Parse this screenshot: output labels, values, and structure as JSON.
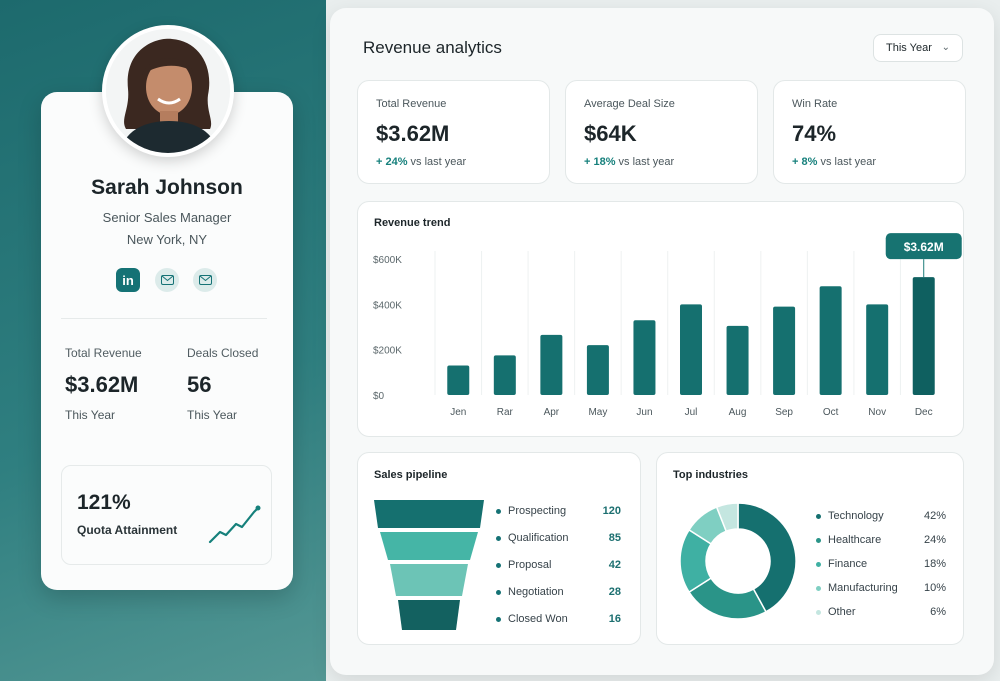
{
  "profile": {
    "name": "Sarah Johnson",
    "title": "Senior Sales Manager",
    "location": "New York, NY",
    "social": {
      "linkedin_label": "in"
    },
    "stats": [
      {
        "label": "Total Revenue",
        "value": "$3.62M",
        "sub": "This Year"
      },
      {
        "label": "Deals Closed",
        "value": "56",
        "sub": "This Year"
      }
    ],
    "quota": {
      "value": "121%",
      "label": "Quota Attainment"
    }
  },
  "header": {
    "title": "Revenue analytics",
    "period_select": "This Year"
  },
  "kpis": [
    {
      "label": "Total Revenue",
      "value": "$3.62M",
      "delta": "+ 24%",
      "delta_suffix": " vs last year"
    },
    {
      "label": "Average Deal Size",
      "value": "$64K",
      "delta": "+ 18%",
      "delta_suffix": " vs last year"
    },
    {
      "label": "Win Rate",
      "value": "74%",
      "delta": "+ 8%",
      "delta_suffix": " vs last year"
    }
  ],
  "colors": {
    "accent": "#157275",
    "accent_light": "#3fb0a3",
    "bar": "#15706f"
  },
  "revenue_trend": {
    "title": "Revenue trend",
    "callout": "$3.62M"
  },
  "chart_data": {
    "type": "bar",
    "title": "Revenue trend",
    "categories": [
      "Jen",
      "Rar",
      "Apr",
      "May",
      "Jun",
      "Jul",
      "Aug",
      "Sep",
      "Oct",
      "Nov",
      "Dec"
    ],
    "values": [
      130000,
      175000,
      265000,
      220000,
      330000,
      400000,
      305000,
      390000,
      480000,
      400000,
      520000
    ],
    "y_ticks": [
      "$0",
      "$200K",
      "$400K",
      "$600K"
    ],
    "ylim": [
      0,
      600000
    ],
    "grid": "vertical",
    "highlight": {
      "category": "Dec",
      "label": "$3.62M"
    }
  },
  "pipeline": {
    "title": "Sales pipeline",
    "stages": [
      {
        "name": "Prospecting",
        "value": "120",
        "color": "#15706f"
      },
      {
        "name": "Qualification",
        "value": "85",
        "color": "#3fb0a3"
      },
      {
        "name": "Proposal",
        "value": "42",
        "color": "#6cc4b6"
      },
      {
        "name": "Negotiation",
        "value": "28",
        "color": "#2a9488"
      },
      {
        "name": "Closed Won",
        "value": "16",
        "color": "#136160"
      }
    ]
  },
  "industries": {
    "title": "Top industries",
    "items": [
      {
        "name": "Technology",
        "value": "42%",
        "share": 42,
        "color": "#15706f"
      },
      {
        "name": "Healthcare",
        "value": "24%",
        "share": 24,
        "color": "#2a9488"
      },
      {
        "name": "Finance",
        "value": "18%",
        "share": 18,
        "color": "#3fb0a3"
      },
      {
        "name": "Manufacturing",
        "value": "10%",
        "share": 10,
        "color": "#7fcfc2"
      },
      {
        "name": "Other",
        "value": "6%",
        "share": 6,
        "color": "#c4e6e0"
      }
    ]
  }
}
